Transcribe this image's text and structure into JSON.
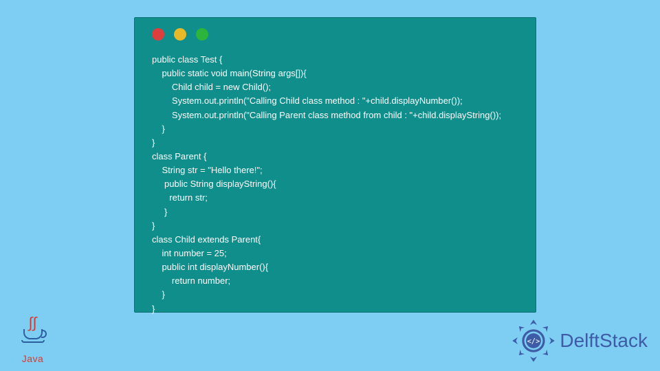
{
  "window": {
    "lights": [
      "red",
      "yellow",
      "green"
    ]
  },
  "code": "public class Test {\n    public static void main(String args[]){\n        Child child = new Child();\n        System.out.println(\"Calling Child class method : \"+child.displayNumber());\n        System.out.println(\"Calling Parent class method from child : \"+child.displayString());\n    }\n}\nclass Parent {\n    String str = \"Hello there!\";\n     public String displayString(){\n       return str;\n     }\n}\nclass Child extends Parent{\n    int number = 25;\n    public int displayNumber(){\n        return number;\n    }\n}",
  "logos": {
    "java_label": "Java",
    "brand_label": "DelftStack"
  },
  "colors": {
    "page_bg": "#7ecef4",
    "window_bg": "#0f8e8b",
    "code_fg": "#ffffff",
    "brand_fg": "#3e5ba6",
    "java_red": "#d63a2e"
  }
}
